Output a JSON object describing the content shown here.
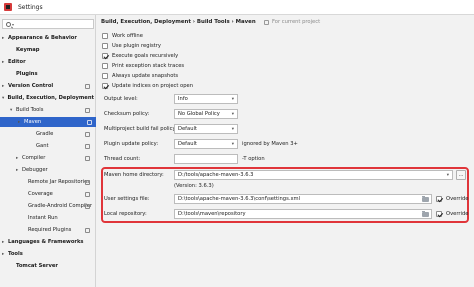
{
  "window": {
    "title": "Settings"
  },
  "sidebar": {
    "search_placeholder": "",
    "items": [
      {
        "label": "Appearance & Behavior",
        "arrow": "›",
        "bold": true,
        "project": false
      },
      {
        "label": "Keymap",
        "arrow": "",
        "bold": true,
        "project": false
      },
      {
        "label": "Editor",
        "arrow": "›",
        "bold": true,
        "project": false
      },
      {
        "label": "Plugins",
        "arrow": "",
        "bold": true,
        "project": false
      },
      {
        "label": "Version Control",
        "arrow": "›",
        "bold": true,
        "project": true
      },
      {
        "label": "Build, Execution, Deployment",
        "arrow": "⌄",
        "bold": true,
        "project": false
      },
      {
        "label": "Build Tools",
        "arrow": "⌄",
        "bold": false,
        "project": true
      },
      {
        "label": "Maven",
        "arrow": "›",
        "bold": false,
        "project": true,
        "selected": true
      },
      {
        "label": "Gradle",
        "arrow": "",
        "bold": false,
        "project": true
      },
      {
        "label": "Gant",
        "arrow": "",
        "bold": false,
        "project": true
      },
      {
        "label": "Compiler",
        "arrow": "›",
        "bold": false,
        "project": true
      },
      {
        "label": "Debugger",
        "arrow": "›",
        "bold": false,
        "project": false
      },
      {
        "label": "Remote Jar Repositories",
        "arrow": "",
        "bold": false,
        "project": true
      },
      {
        "label": "Coverage",
        "arrow": "",
        "bold": false,
        "project": true
      },
      {
        "label": "Gradle-Android Compiler",
        "arrow": "",
        "bold": false,
        "project": true
      },
      {
        "label": "Instant Run",
        "arrow": "",
        "bold": false,
        "project": false
      },
      {
        "label": "Required Plugins",
        "arrow": "",
        "bold": false,
        "project": true
      },
      {
        "label": "Languages & Frameworks",
        "arrow": "›",
        "bold": true,
        "project": false
      },
      {
        "label": "Tools",
        "arrow": "›",
        "bold": true,
        "project": false
      },
      {
        "label": "Tomcat Server",
        "arrow": "",
        "bold": true,
        "project": false
      }
    ]
  },
  "content": {
    "breadcrumb": "Build, Execution, Deployment  ›  Build Tools  ›  Maven",
    "for_project": "For current project",
    "checkboxes": [
      {
        "label": "Work offline",
        "checked": false
      },
      {
        "label": "Use plugin registry",
        "checked": false
      },
      {
        "label": "Execute goals recursively",
        "checked": true
      },
      {
        "label": "Print exception stack traces",
        "checked": false
      },
      {
        "label": "Always update snapshots",
        "checked": false
      },
      {
        "label": "Update indices on project open",
        "checked": true
      }
    ],
    "fields": {
      "output_level": {
        "label": "Output level:",
        "value": "Info"
      },
      "checksum_policy": {
        "label": "Checksum policy:",
        "value": "No Global Policy"
      },
      "multiproject_fail": {
        "label": "Multiproject build fail policy:",
        "value": "Default"
      },
      "plugin_update": {
        "label": "Plugin update policy:",
        "value": "Default",
        "hint": "ignored by Maven 3+"
      },
      "thread_count": {
        "label": "Thread count:",
        "value": "",
        "hint": "-T option"
      },
      "maven_home": {
        "label": "Maven home directory:",
        "value": "D:/tools/apache-maven-3.6.3",
        "version": "(Version: 3.6.3)",
        "more": "..."
      },
      "user_settings": {
        "label": "User settings file:",
        "value": "D:\\tools\\apache-maven-3.6.3\\conf\\settings.xml",
        "override": "Override"
      },
      "local_repo": {
        "label": "Local repository:",
        "value": "D:\\tools\\maven\\repository",
        "override": "Override"
      }
    }
  }
}
